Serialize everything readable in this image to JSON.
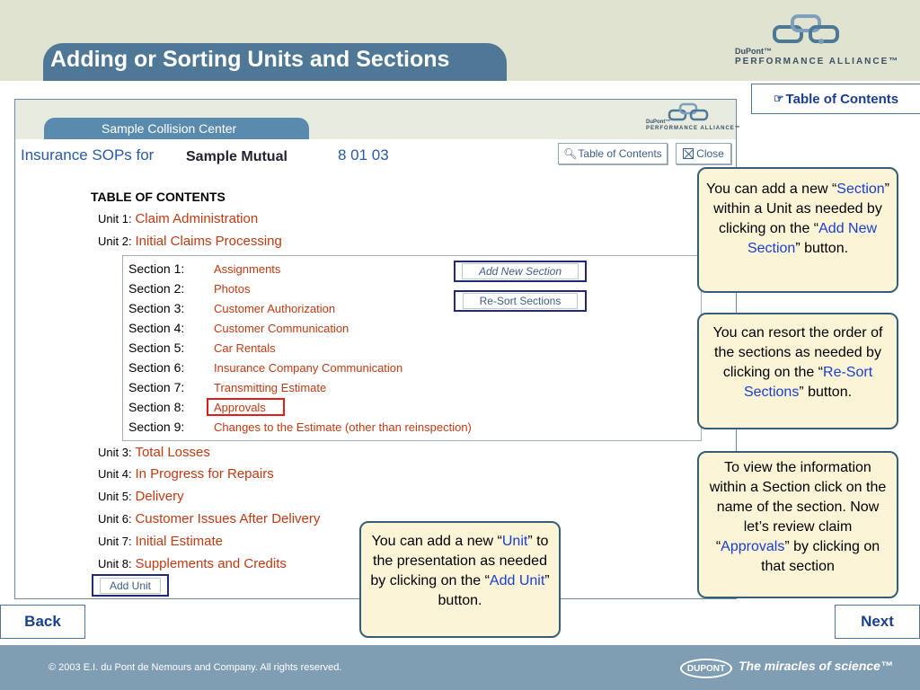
{
  "header": {
    "title": "Adding or Sorting Units and Sections",
    "brand_line1": "DuPont™",
    "brand_line2": "PERFORMANCE ALLIANCE™",
    "toc_button": "Table of Contents"
  },
  "app": {
    "center_tab": "Sample Collision Center",
    "brand_line1": "DuPont™",
    "brand_line2": "PERFORMANCE ALLIANCE™",
    "heading_prefix": "Insurance SOPs for",
    "heading_suffix": "8 01 03",
    "mutual": "Sample Mutual",
    "toc_button": "Table of Contents",
    "close_button": "Close",
    "toc_heading": "TABLE OF CONTENTS",
    "units_top": [
      {
        "prefix": "Unit 1:",
        "name": "Claim Administration"
      },
      {
        "prefix": "Unit 2:",
        "name": "Initial Claims Processing"
      }
    ],
    "sections": [
      {
        "prefix": "Section 1:",
        "name": "Assignments"
      },
      {
        "prefix": "Section 2:",
        "name": "Photos"
      },
      {
        "prefix": "Section 3:",
        "name": "Customer Authorization"
      },
      {
        "prefix": "Section 4:",
        "name": "Customer Communication"
      },
      {
        "prefix": "Section 5:",
        "name": "Car Rentals"
      },
      {
        "prefix": "Section 6:",
        "name": "Insurance Company Communication"
      },
      {
        "prefix": "Section 7:",
        "name": "Transmitting Estimate"
      },
      {
        "prefix": "Section 8:",
        "name": "Approvals"
      },
      {
        "prefix": "Section 9:",
        "name": "Changes to the Estimate (other than reinspection)"
      }
    ],
    "add_section_button": "Add New Section",
    "resort_button": "Re-Sort Sections",
    "units_bottom": [
      {
        "prefix": "Unit 3:",
        "name": "Total Losses"
      },
      {
        "prefix": "Unit 4:",
        "name": "In Progress for Repairs"
      },
      {
        "prefix": "Unit 5:",
        "name": "Delivery"
      },
      {
        "prefix": "Unit 6:",
        "name": "Customer Issues After Delivery"
      },
      {
        "prefix": "Unit 7:",
        "name": "Initial Estimate"
      },
      {
        "prefix": "Unit 8:",
        "name": "Supplements and Credits"
      }
    ],
    "add_unit_button": "Add Unit"
  },
  "callouts": {
    "add_section": {
      "t1": "You can add a new “",
      "hl1": "Section",
      "t2": "” within a Unit as needed by clicking on the “",
      "hl2": "Add New Section",
      "t3": "” button."
    },
    "resort": {
      "t1": "You can resort the order of the sections as needed by clicking on the “",
      "hl1": "Re-Sort Sections",
      "t2": "” button."
    },
    "view": {
      "t1": "To view the information within a Section click on the name of the section. Now let’s review claim “",
      "hl1": "Approvals",
      "t2": "” by clicking on that section"
    },
    "add_unit": {
      "t1": "You can add a new “",
      "hl1": "Unit",
      "t2": "” to the presentation as needed by clicking on the “",
      "hl2": "Add Unit",
      "t3": "” button."
    }
  },
  "nav": {
    "back": "Back",
    "next": "Next"
  },
  "footer": {
    "copyright": "© 2003 E.I. du Pont de Nemours and Company. All rights reserved.",
    "logo_text": "DUPONT",
    "tagline": "The miracles of science™"
  },
  "colors": {
    "accent": "#4e7896",
    "link": "#c03a12",
    "highlight": "#1a3fcf",
    "callout_bg": "#fcf4d7"
  }
}
